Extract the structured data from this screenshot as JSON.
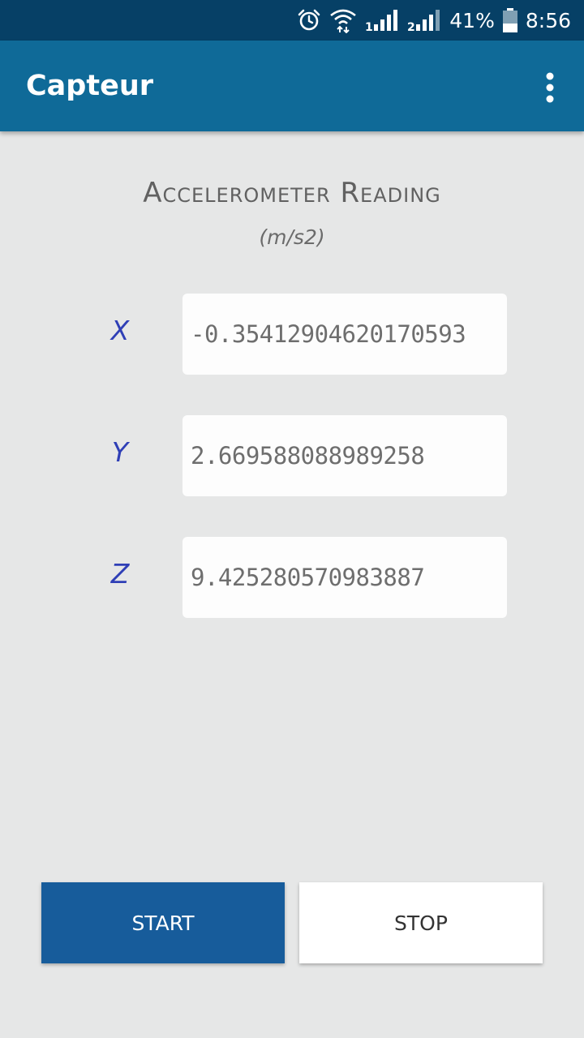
{
  "status_bar": {
    "battery_percent": "41%",
    "battery_level": 0.41,
    "time": "8:56",
    "icons": [
      "alarm-icon",
      "wifi-icon",
      "signal-sim1-icon",
      "signal-sim2-icon",
      "battery-icon"
    ],
    "background_color": "#064066"
  },
  "app_bar": {
    "title": "Capteur",
    "menu_icon": "more-vert-icon",
    "background_color": "#0f6a98"
  },
  "reading": {
    "title": "Accelerometer Reading",
    "unit": "(m/s2)"
  },
  "axes": [
    {
      "label": "X",
      "value": "-0.35412904620170593"
    },
    {
      "label": "Y",
      "value": "2.669588088989258"
    },
    {
      "label": "Z",
      "value": "9.425280570983887"
    }
  ],
  "buttons": {
    "start_label": "START",
    "stop_label": "STOP",
    "start_color": "#175c9b"
  },
  "colors": {
    "axis_label": "#2f3fb6",
    "background": "#e6e7e7"
  }
}
